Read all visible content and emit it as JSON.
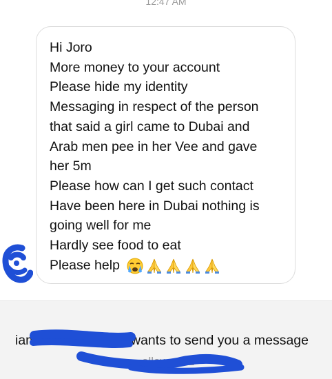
{
  "header": {
    "timestamp": "12:47 AM"
  },
  "message": {
    "lines": [
      "Hi Joro",
      "More money to your account",
      "Please hide my identity",
      "Messaging in respect of the person",
      "that said a girl came to Dubai and",
      "Arab men pee in her Vee and gave",
      "her 5m",
      "Please how can I get such contact",
      "Have been here in Dubai nothing is",
      "going well for me",
      "Hardly see food to eat",
      "Please help"
    ],
    "emojis": [
      "crying-face-emoji",
      "folded-hands-emoji",
      "folded-hands-emoji",
      "folded-hands-emoji",
      "folded-hands-emoji"
    ]
  },
  "request": {
    "sender_prefix": "iam",
    "text": "wants to send you a message",
    "followers_label": "ollowers 2"
  },
  "colors": {
    "bubble_border": "#dcdcdc",
    "footer_bg": "#f3f3f3",
    "redaction": "#1f4fd6",
    "muted_text": "#9a9a9a"
  }
}
